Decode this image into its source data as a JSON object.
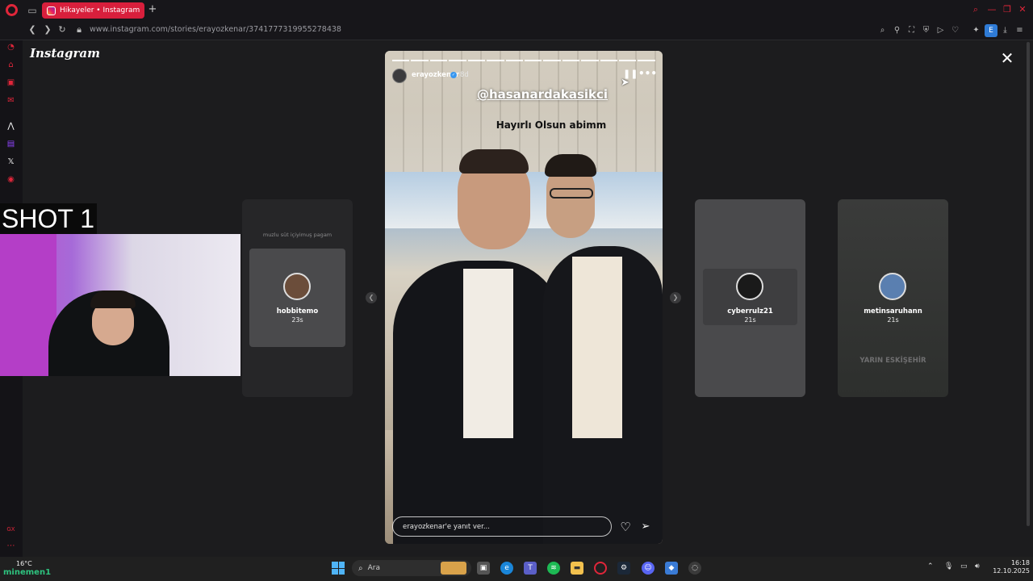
{
  "browser": {
    "tab_title": "Hikayeler • Instagram",
    "new_tab_symbol": "+",
    "url": "www.instagram.com/stories/erayozkenar/3741777319955278438",
    "extension_badge": "E"
  },
  "instagram": {
    "logo": "Instagram",
    "story": {
      "username": "erayozkenar",
      "time": "8d",
      "mention": "@hasanardakasikci",
      "caption": "Hayırlı Olsun abimm",
      "segments_total": 14,
      "segments_viewed": 14,
      "reply_placeholder": "erayozkenar'e yanıt ver..."
    },
    "side_stories": [
      {
        "username": "hobbitemo",
        "time": "23s",
        "label": "muzlu süt içiyimuş pagam"
      },
      {
        "username": "cyberrulz21",
        "time": "21s"
      },
      {
        "username": "metinsaruhann",
        "time": "21s",
        "label": "YARIN ESKİŞEHİR"
      }
    ]
  },
  "overlay": {
    "shot_label": "SHOT 1"
  },
  "taskbar": {
    "weather_temp": "16°C",
    "weather_text": "minemen1",
    "search_text": "Ara",
    "time": "16:18",
    "date": "12.10.2025"
  },
  "colors": {
    "opera_red": "#e0263a",
    "tab_active": "#d81f3c",
    "verified": "#3897f0"
  }
}
